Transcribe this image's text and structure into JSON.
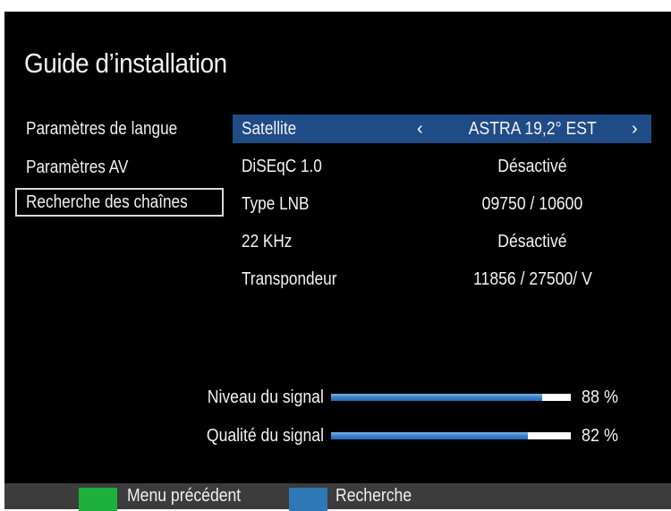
{
  "screen": {
    "title": "Guide d’installation"
  },
  "sidebar": {
    "items": [
      {
        "label": "Paramètres de langue"
      },
      {
        "label": "Paramètres AV"
      },
      {
        "label": "Recherche des chaînes",
        "selected": true
      }
    ]
  },
  "settings": {
    "rows": [
      {
        "label": "Satellite",
        "value": "ASTRA 19,2° EST",
        "left_arrow": "‹",
        "right_arrow": "›"
      },
      {
        "label": "DiSEqC 1.0",
        "value": "Désactivé"
      },
      {
        "label": "Type LNB",
        "value": "09750 / 10600"
      },
      {
        "label": "22 KHz",
        "value": "Désactivé"
      },
      {
        "label": "Transpondeur",
        "value": "11856 / 27500/ V"
      }
    ]
  },
  "signal": {
    "level": {
      "label": "Niveau du signal",
      "percent_text": "88 %",
      "fraction": 0.88
    },
    "quality": {
      "label": "Qualité du signal",
      "percent_text": "82 %",
      "fraction": 0.82
    }
  },
  "footer": {
    "green_label": "Menu précédent",
    "blue_label": "Recherche"
  },
  "colors": {
    "highlight": "#1f4c86",
    "green_key": "#1db03a",
    "blue_key": "#2e78b5",
    "bar_fill": "#3b82cc"
  }
}
